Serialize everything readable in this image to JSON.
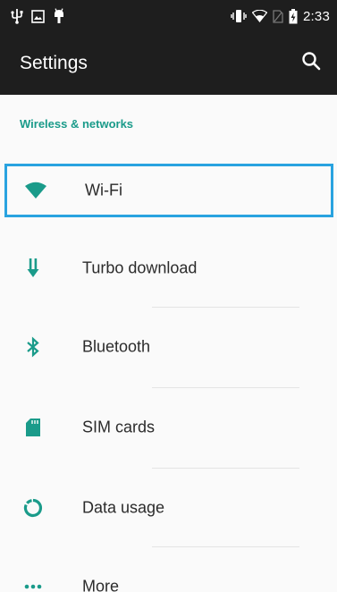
{
  "status_bar": {
    "time": "2:33",
    "left_icons": [
      "usb-icon",
      "image-notification-icon",
      "android-debug-icon"
    ],
    "right_icons": [
      "vibrate-icon",
      "wifi-signal-icon",
      "no-sim-icon",
      "battery-charging-icon"
    ]
  },
  "toolbar": {
    "title": "Settings",
    "search_icon": "search-icon"
  },
  "section": {
    "header": "Wireless & networks"
  },
  "items": [
    {
      "label": "Wi-Fi",
      "icon": "wifi-icon",
      "focused": true
    },
    {
      "label": "Turbo download",
      "icon": "download-arrow-icon"
    },
    {
      "label": "Bluetooth",
      "icon": "bluetooth-icon"
    },
    {
      "label": "SIM cards",
      "icon": "sim-card-icon"
    },
    {
      "label": "Data usage",
      "icon": "data-usage-icon"
    },
    {
      "label": "More",
      "icon": "more-dots-icon"
    }
  ],
  "colors": {
    "toolbar_bg": "#1e1e1e",
    "accent": "#1a9b8a",
    "focus_border": "#29a3e0",
    "icon_teal": "#1a9b8a",
    "background": "#fafafa"
  }
}
